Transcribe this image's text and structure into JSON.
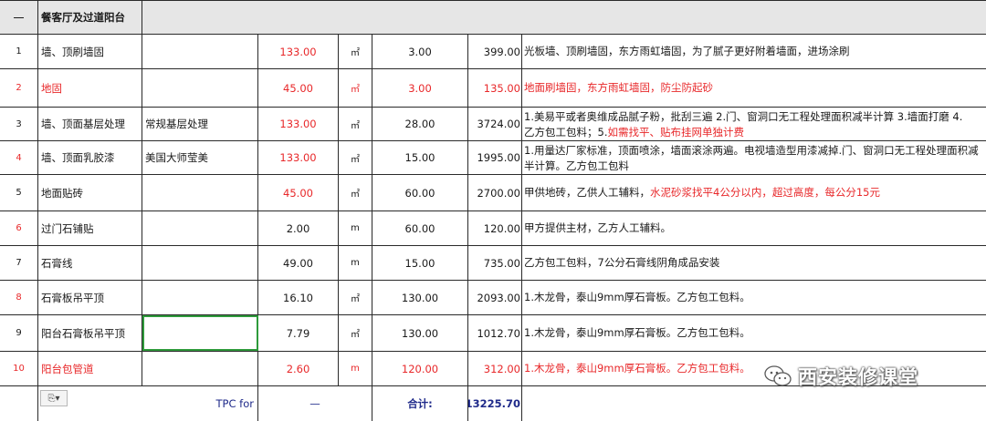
{
  "header": {
    "collapse_symbol": "一",
    "section_title": "餐客厅及过道阳台"
  },
  "rows": [
    {
      "idx": "1",
      "name": "墙、顶刷墙固",
      "brand": "",
      "qty": "133.00",
      "unit": "㎡",
      "price": "3.00",
      "total": "399.00",
      "note": "光板墙、顶刷墙固，东方雨虹墙固，为了腻子更好附着墙面，进场涂刷"
    },
    {
      "idx": "2",
      "name": "地固",
      "brand": "",
      "qty": "45.00",
      "unit": "㎡",
      "price": "3.00",
      "total": "135.00",
      "note": "地面刷墙固，东方雨虹墙固，防尘防起砂"
    },
    {
      "idx": "3",
      "name": "墙、顶面基层处理",
      "brand": "常规基层处理",
      "qty": "133.00",
      "unit": "㎡",
      "price": "28.00",
      "total": "3724.00",
      "note_line1": "1.美易平或者奥维成品腻子粉，批刮三遍 2.门、窗洞口无工程处理面积减半计算 3.墙面打磨 4.",
      "note_line2a": "乙方包工包料；5.",
      "note_line2b": "如需找平、贴布挂网单独计费"
    },
    {
      "idx": "4",
      "name": "墙、顶面乳胶漆",
      "brand": "美国大师莹美",
      "qty": "133.00",
      "unit": "㎡",
      "price": "15.00",
      "total": "1995.00",
      "note": "1.用量达厂家标准，顶面喷涂，墙面滚涂两遍。电视墙造型用漆减掉.门、窗洞口无工程处理面积减半计算。乙方包工包料"
    },
    {
      "idx": "5",
      "name": "地面贴砖",
      "brand": "",
      "qty": "45.00",
      "unit": "㎡",
      "price": "60.00",
      "total": "2700.00",
      "note_a": "甲供地砖，乙供人工辅料，",
      "note_b": "水泥砂浆找平4公分以内，超过高度，每公分15元"
    },
    {
      "idx": "6",
      "name": "过门石铺贴",
      "brand": "",
      "qty": "2.00",
      "unit": "m",
      "price": "60.00",
      "total": "120.00",
      "note": "甲方提供主材，乙方人工辅料。"
    },
    {
      "idx": "7",
      "name": "石膏线",
      "brand": "",
      "qty": "49.00",
      "unit": "m",
      "price": "15.00",
      "total": "735.00",
      "note": "乙方包工包料，7公分石膏线阴角成品安装"
    },
    {
      "idx": "8",
      "name": "石膏板吊平顶",
      "brand": "",
      "qty": "16.10",
      "unit": "㎡",
      "price": "130.00",
      "total": "2093.00",
      "note": "1.木龙骨，泰山9mm厚石膏板。乙方包工包料。"
    },
    {
      "idx": "9",
      "name": "阳台石膏板吊平顶",
      "brand": "",
      "qty": "7.79",
      "unit": "㎡",
      "price": "130.00",
      "total": "1012.70",
      "note": "1.木龙骨，泰山9mm厚石膏板。乙方包工包料。"
    },
    {
      "idx": "10",
      "name": "阳台包管道",
      "brand": "",
      "qty": "2.60",
      "unit": "m",
      "price": "120.00",
      "total": "312.00",
      "note": "1.木龙骨，泰山9mm厚石膏板。乙方包工包料。"
    }
  ],
  "footer": {
    "paste_label": "⎘▾",
    "tpc_label": "TPC for",
    "dash": "—",
    "sum_label": "合计:",
    "sum_value": "13225.70"
  },
  "watermark": {
    "text": "西安装修课堂",
    "icon": "wechat-icon"
  },
  "colors": {
    "red_text": "#e8282a",
    "header_bg": "#e6e6e6",
    "selection": "#2e9a3b",
    "footer_text": "#1f2a8a"
  }
}
